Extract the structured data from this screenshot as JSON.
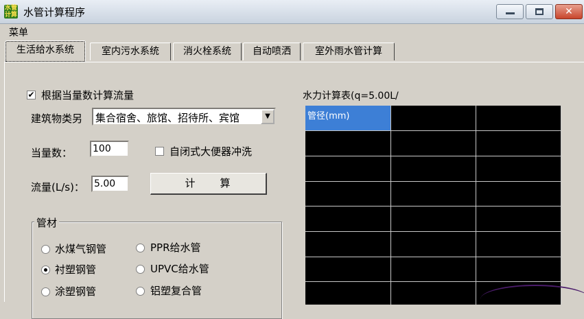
{
  "window": {
    "title": "水管计算程序",
    "app_icon_text": "水管\n计算",
    "controls": {
      "minimize": "minimize-icon",
      "maximize": "maximize-icon",
      "close": "close-icon"
    }
  },
  "menu": {
    "items": [
      "菜单"
    ]
  },
  "tabs": [
    {
      "label": "生活给水系统",
      "active": true
    },
    {
      "label": "室内污水系统",
      "active": false
    },
    {
      "label": "消火栓系统",
      "active": false
    },
    {
      "label": "自动喷洒",
      "active": false
    },
    {
      "label": "室外雨水管计算",
      "active": false
    }
  ],
  "form": {
    "use_equivalent": {
      "label": "根据当量数计算流量",
      "checked": true
    },
    "building_type": {
      "label": "建筑物类另",
      "value": "集合宿舍、旅馆、招待所、宾馆"
    },
    "equivalent": {
      "label": "当量数：",
      "value": "100"
    },
    "self_closing": {
      "label": "自闭式大便器冲洗",
      "checked": false
    },
    "flow": {
      "label": "流量(L/s)：",
      "value": "5.00"
    },
    "calculate_button": "计　　算"
  },
  "pipe_material": {
    "title": "管材",
    "options": [
      {
        "label": "水煤气钢管",
        "selected": false
      },
      {
        "label": "PPR给水管",
        "selected": false
      },
      {
        "label": "衬塑钢管",
        "selected": true
      },
      {
        "label": "UPVC给水管",
        "selected": false
      },
      {
        "label": "涂塑钢管",
        "selected": false
      },
      {
        "label": "铝塑复合管",
        "selected": false
      }
    ]
  },
  "hydraulic_table": {
    "title": "水力计算表(q=5.00L/",
    "header": "管径(mm)"
  },
  "colors": {
    "grid_bg": "#000000",
    "header_selected": "#3d7fd6",
    "face": "#d4d0c8"
  }
}
